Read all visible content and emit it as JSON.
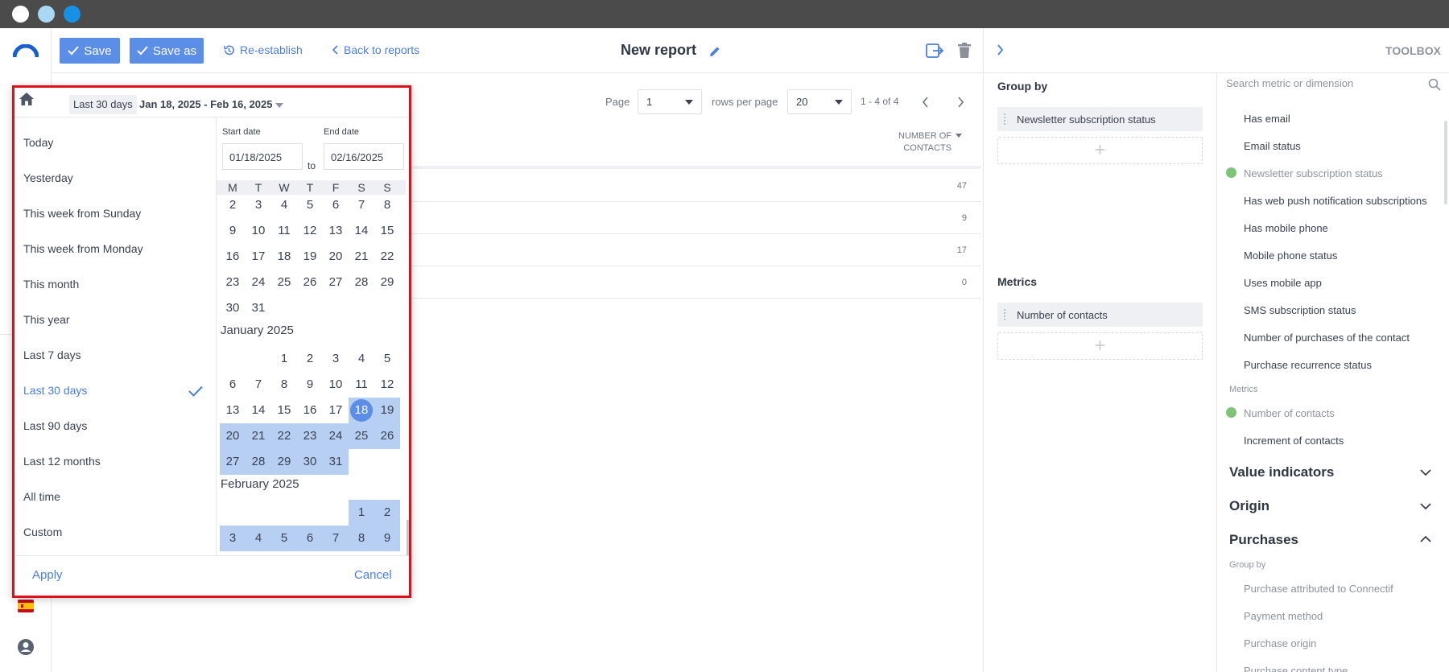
{
  "header": {
    "save_label": "Save",
    "save_as_label": "Save as",
    "reestablish_label": "Re-establish",
    "back_label": "Back to reports",
    "report_title": "New report"
  },
  "picker": {
    "current_preset": "Last 30 days",
    "range_label": "Jan 18, 2025 - Feb 16, 2025",
    "presets": [
      "Today",
      "Yesterday",
      "This week from Sunday",
      "This week from Monday",
      "This month",
      "This year",
      "Last 7 days",
      "Last 30 days",
      "Last 90 days",
      "Last 12 months",
      "All time",
      "Custom"
    ],
    "start_date_label": "Start date",
    "end_date_label": "End date",
    "start_date": "01/18/2025",
    "end_date": "02/16/2025",
    "to_label": "to",
    "weekdays": [
      "M",
      "T",
      "W",
      "T",
      "F",
      "S",
      "S"
    ],
    "prev_month_rows": [
      [
        "2",
        "3",
        "4",
        "5",
        "6",
        "7",
        "8"
      ],
      [
        "9",
        "10",
        "11",
        "12",
        "13",
        "14",
        "15"
      ],
      [
        "16",
        "17",
        "18",
        "19",
        "20",
        "21",
        "22"
      ],
      [
        "23",
        "24",
        "25",
        "26",
        "27",
        "28",
        "29"
      ],
      [
        "30",
        "31"
      ]
    ],
    "month1": "January 2025",
    "month1_rows": [
      [
        "",
        "",
        "1",
        "2",
        "3",
        "4",
        "5"
      ],
      [
        "6",
        "7",
        "8",
        "9",
        "10",
        "11",
        "12"
      ],
      [
        "13",
        "14",
        "15",
        "16",
        "17",
        "18",
        "19"
      ],
      [
        "20",
        "21",
        "22",
        "23",
        "24",
        "25",
        "26"
      ],
      [
        "27",
        "28",
        "29",
        "30",
        "31"
      ]
    ],
    "month2": "February 2025",
    "month2_rows": [
      [
        "",
        "",
        "",
        "",
        "",
        "1",
        "2"
      ],
      [
        "3",
        "4",
        "5",
        "6",
        "7",
        "8",
        "9"
      ]
    ],
    "apply_label": "Apply",
    "cancel_label": "Cancel"
  },
  "pagination": {
    "page_label": "Page",
    "page_value": "1",
    "rows_label": "rows per page",
    "rows_value": "20",
    "range": "1 - 4 of 4"
  },
  "table": {
    "col_header_1": "NUMBER OF",
    "col_header_2": "CONTACTS",
    "values": [
      "47",
      "9",
      "17",
      "0"
    ]
  },
  "config": {
    "group_by_title": "Group by",
    "group_by_item": "Newsletter subscription status",
    "metrics_title": "Metrics",
    "metrics_item": "Number of contacts",
    "plus": "+"
  },
  "toolbox": {
    "title": "TOOLBOX",
    "search_placeholder": "Search metric or dimension",
    "items": [
      {
        "label": "Has email",
        "used": false
      },
      {
        "label": "Email status",
        "used": false
      },
      {
        "label": "Newsletter subscription status",
        "used": true
      },
      {
        "label": "Has web push notification subscriptions",
        "used": false
      },
      {
        "label": "Has mobile phone",
        "used": false
      },
      {
        "label": "Mobile phone status",
        "used": false
      },
      {
        "label": "Uses mobile app",
        "used": false
      },
      {
        "label": "SMS subscription status",
        "used": false
      },
      {
        "label": "Number of purchases of the contact",
        "used": false
      },
      {
        "label": "Purchase recurrence status",
        "used": false
      }
    ],
    "metrics_sub": "Metrics",
    "metric_items": [
      {
        "label": "Number of contacts",
        "used": true
      },
      {
        "label": "Increment of contacts",
        "used": false
      }
    ],
    "sections": [
      "Value indicators",
      "Origin",
      "Purchases"
    ],
    "purchases_sub": "Group by",
    "purchases_items": [
      "Purchase attributed to Connectif",
      "Payment method",
      "Purchase origin",
      "Purchase content type"
    ]
  },
  "colors": {
    "accent": "#5b8ee6",
    "range": "#b8cff4",
    "highlight_border": "#e0101a",
    "titlebar": "#4b4b4b"
  }
}
